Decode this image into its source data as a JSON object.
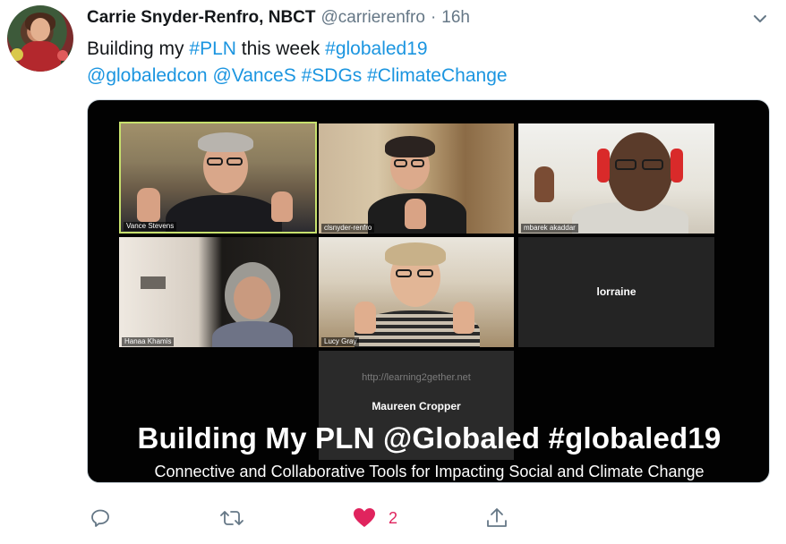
{
  "tweet": {
    "author_name": "Carrie Snyder-Renfro, NBCT",
    "author_handle": "@carrierenfro",
    "separator": "·",
    "time": "16h",
    "text_line1": [
      {
        "text": "Building my ",
        "tag": false
      },
      {
        "text": "#PLN",
        "tag": true
      },
      {
        "text": " this week ",
        "tag": false
      },
      {
        "text": "#globaled19",
        "tag": true
      }
    ],
    "text_line2": [
      {
        "text": "@globaledcon",
        "tag": true
      },
      {
        "text": " ",
        "tag": false
      },
      {
        "text": "@VanceS",
        "tag": true
      },
      {
        "text": " ",
        "tag": false
      },
      {
        "text": "#SDGs",
        "tag": true
      },
      {
        "text": " ",
        "tag": false
      },
      {
        "text": "#ClimateChange",
        "tag": true
      }
    ]
  },
  "media": {
    "tiles": {
      "t1": "Vance Stevens",
      "t2": "clsnyder-renfro",
      "t3": "mbarek akaddar",
      "t4": "Hanaa Khamis",
      "t5": "Lucy Gray",
      "t6": "lorraine",
      "t7_url": "http://learning2gether.net",
      "t7_name": "Maureen Cropper"
    },
    "title": "Building My PLN @Globaled #globaled19",
    "subtitle": "Connective and Collaborative Tools for Impacting Social and Climate Change"
  },
  "actions": {
    "reply_icon": "reply-icon",
    "retweet_icon": "retweet-icon",
    "like_icon": "heart-icon",
    "like_count": "2",
    "share_icon": "share-icon"
  },
  "colors": {
    "link": "#1b95e0",
    "like": "#e0245e",
    "muted": "#657786",
    "active_speaker_border": "#c7e06d"
  }
}
